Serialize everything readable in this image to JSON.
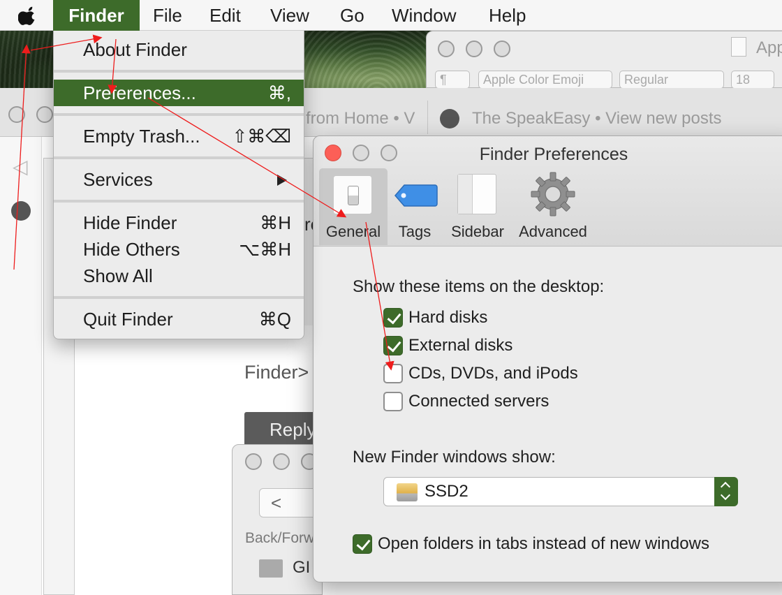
{
  "menubar": {
    "apple_icon": "apple-logo-icon",
    "items": [
      "Finder",
      "File",
      "Edit",
      "View",
      "Go",
      "Window",
      "Help"
    ]
  },
  "finder_menu": {
    "about": "About Finder",
    "preferences": "Preferences...",
    "preferences_shortcut": "⌘,",
    "empty_trash": "Empty Trash...",
    "empty_trash_shortcut": "⇧⌘⌫",
    "services": "Services",
    "hide_finder": "Hide Finder",
    "hide_finder_shortcut": "⌘H",
    "hide_others": "Hide Others",
    "hide_others_shortcut": "⌥⌘H",
    "show_all": "Show All",
    "quit": "Quit Finder",
    "quit_shortcut": "⌘Q"
  },
  "textedit": {
    "title": "App",
    "font_family": "Apple Color Emoji",
    "font_style": "Regular",
    "font_size": "18",
    "paragraph": "¶"
  },
  "safari": {
    "tab1": "from Home • V",
    "tab2": "The SpeakEasy • View new posts",
    "crumb": "Finder>",
    "reply": "Reply",
    "partial_text": "re"
  },
  "finder_window": {
    "nav_label": "Back/Forw",
    "item": "GI"
  },
  "prefs": {
    "title": "Finder Preferences",
    "tabs": [
      "General",
      "Tags",
      "Sidebar",
      "Advanced"
    ],
    "desktop_heading": "Show these items on the desktop:",
    "desktop_items": [
      {
        "label": "Hard disks",
        "checked": true
      },
      {
        "label": "External disks",
        "checked": true
      },
      {
        "label": "CDs, DVDs, and iPods",
        "checked": false
      },
      {
        "label": "Connected servers",
        "checked": false
      }
    ],
    "new_windows_label": "New Finder windows show:",
    "new_windows_value": "SSD2",
    "tabs_option": {
      "label": "Open folders in tabs instead of new windows",
      "checked": true
    }
  },
  "colors": {
    "accent": "#3d6b2a",
    "annotation": "#ee1c1c",
    "close": "#fc5f57"
  }
}
